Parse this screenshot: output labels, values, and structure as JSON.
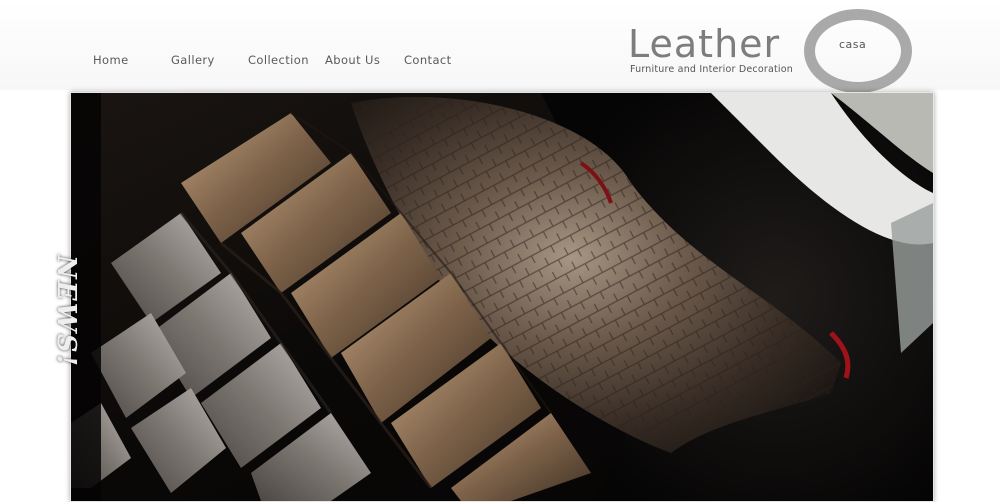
{
  "nav": {
    "items": [
      {
        "label": "Home"
      },
      {
        "label": "Gallery"
      },
      {
        "label": "Collection"
      },
      {
        "label": "About Us"
      },
      {
        "label": "Contact"
      }
    ]
  },
  "logo": {
    "word": "Leather",
    "sub": "casa",
    "tagline": "Furniture and Interior Decoration",
    "ring_color": "#a9a9a9",
    "text_color": "#7d7d7d"
  },
  "hero": {
    "badge": "NEWS!"
  }
}
